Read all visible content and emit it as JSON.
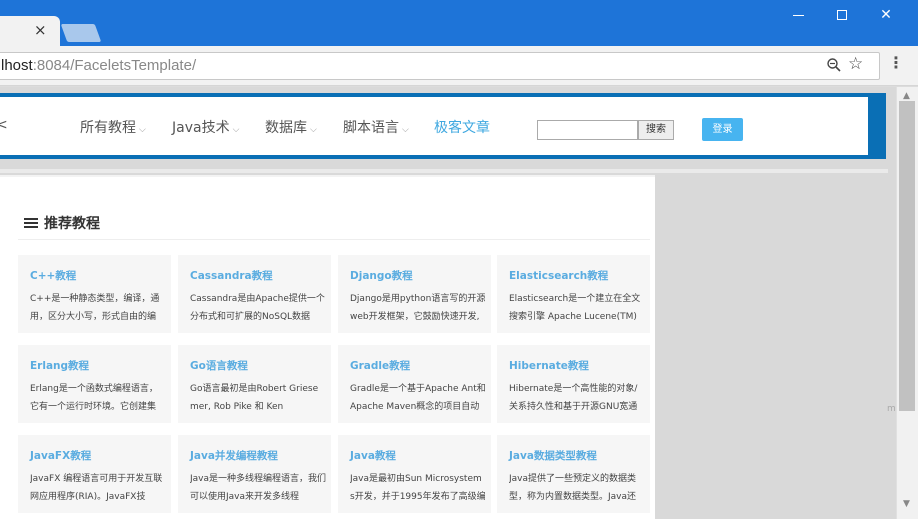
{
  "browser": {
    "tab_close": "×",
    "window_controls": {
      "minimize": "",
      "maximize": "",
      "close": "✕"
    },
    "url_host": "lhost",
    "url_rest": ":8084/FaceletsTemplate/",
    "zoom_icon": "zoom-icon",
    "star": "☆",
    "menu": "⋮"
  },
  "header": {
    "logo_fragment": "<",
    "nav": [
      {
        "label": "所有教程",
        "chevron": "⌵",
        "active": false
      },
      {
        "label": "Java技术",
        "chevron": "⌵",
        "active": false
      },
      {
        "label": "数据库",
        "chevron": "⌵",
        "active": false
      },
      {
        "label": "脚本语言",
        "chevron": "⌵",
        "active": false
      },
      {
        "label": "极客文章",
        "chevron": "",
        "active": true
      }
    ],
    "search_value": "",
    "search_button": "搜索",
    "login_button": "登录"
  },
  "section": {
    "title": "推荐教程"
  },
  "courses": [
    {
      "title": "C++教程",
      "desc": "C++是一种静态类型，编译，通用，区分大小写，形式自由的编"
    },
    {
      "title": "Cassandra教程",
      "desc": "Cassandra是由Apache提供一个分布式和可扩展的NoSQL数据"
    },
    {
      "title": "Django教程",
      "desc": "Django是用python语言写的开源web开发框架，它鼓励快速开发,"
    },
    {
      "title": "Elasticsearch教程",
      "desc": "Elasticsearch是一个建立在全文搜索引擎 Apache Lucene(TM)"
    },
    {
      "title": "Erlang教程",
      "desc": "Erlang是一个函数式编程语言，它有一个运行时环境。它创建集"
    },
    {
      "title": "Go语言教程",
      "desc": "Go语言最初是由Robert Griesemer, Rob Pike 和 Ken"
    },
    {
      "title": "Gradle教程",
      "desc": "Gradle是一个基于Apache Ant和Apache Maven概念的项目自动"
    },
    {
      "title": "Hibernate教程",
      "desc": "Hibernate是一个高性能的对象/关系持久性和基于开源GNU宽通"
    },
    {
      "title": "JavaFX教程",
      "desc": "JavaFX 编程语言可用于开发互联网应用程序(RIA)。JavaFX技"
    },
    {
      "title": "Java并发编程教程",
      "desc": "Java是一种多线程编程语言，我们可以使用Java来开发多线程"
    },
    {
      "title": "Java教程",
      "desc": "Java是最初由Sun Microsystems开发，并于1995年发布了高级编"
    },
    {
      "title": "Java数据类型教程",
      "desc": "Java提供了一些预定义的数据类型，称为内置数据类型。Java还"
    }
  ],
  "scrollbar": {
    "up": "▲",
    "down": "▼",
    "corner_text": "m"
  }
}
